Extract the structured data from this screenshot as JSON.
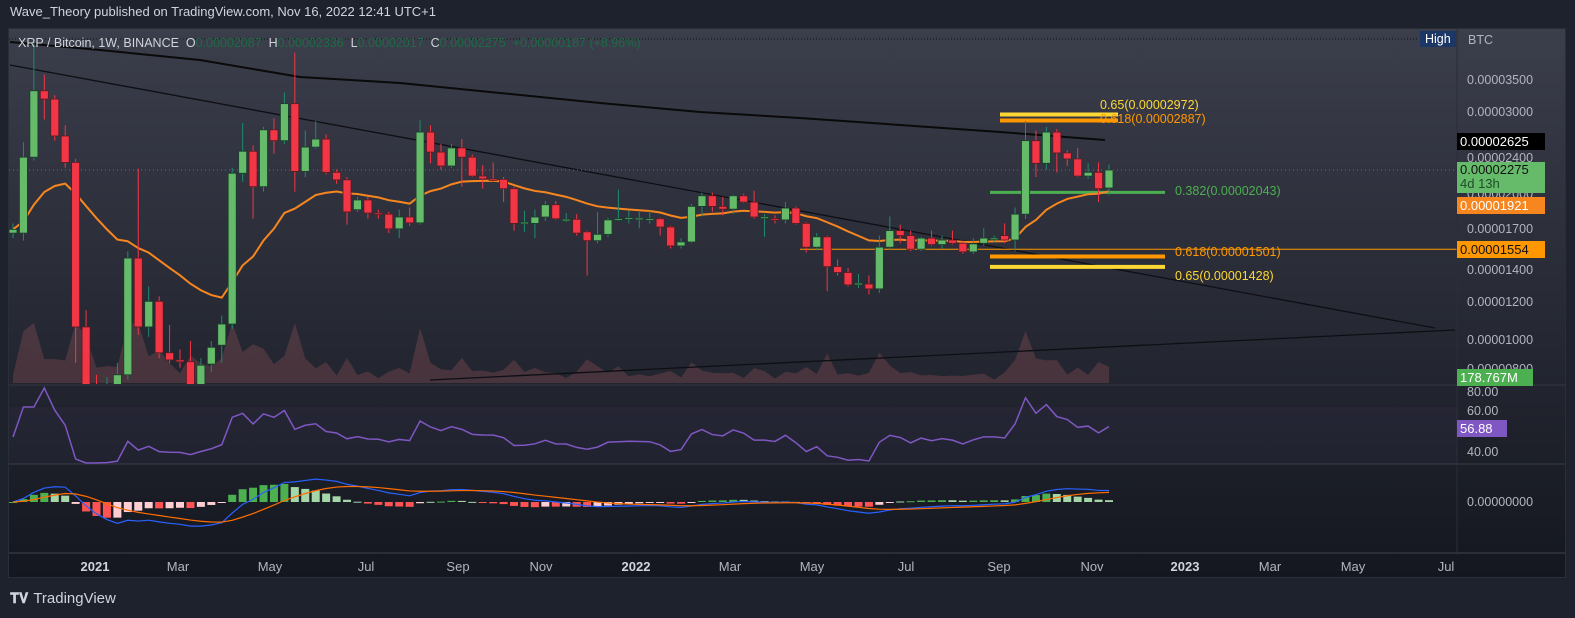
{
  "header": {
    "published": "Wave_Theory published on TradingView.com, Nov 16, 2022 12:41 UTC+1"
  },
  "legend": {
    "symbol": "XRP / Bitcoin, 1W, BINANCE",
    "o_label": "O",
    "o": "0.00002087",
    "h_label": "H",
    "h": "0.00002336",
    "l_label": "L",
    "l": "0.00002017",
    "c_label": "C",
    "c": "0.00002275",
    "change": "+0.00000187 (+8.96%)"
  },
  "scale": {
    "high_badge": "High",
    "currency": "BTC",
    "ticks": [
      "0.00003500",
      "0.00003000",
      "0.00002400",
      "0.00002000",
      "0.00001700",
      "0.00001400",
      "0.00001200",
      "0.00001000",
      "0.00000800"
    ],
    "ma200_tag": "0.00002625",
    "last_price_tag": "0.00002275",
    "countdown": "4d 13h",
    "ema_tag": "0.00001921",
    "hline_tag": "0.00001554",
    "volume_tag": "178.767M",
    "rsi_ticks": [
      "80.00",
      "60.00",
      "40.00"
    ],
    "rsi_tag": "56.88",
    "macd_tick": "0.00000000"
  },
  "fib": [
    {
      "label": "0.65(0.00002972)",
      "price": 2972,
      "color": "#fdd835"
    },
    {
      "label": "0.618(0.00002887)",
      "price": 2887,
      "color": "#ff9800"
    },
    {
      "label": "0.382(0.00002043)",
      "price": 2043,
      "color": "#4caf50"
    },
    {
      "label": "0.618(0.00001501)",
      "price": 1501,
      "color": "#ff9800"
    },
    {
      "label": "0.65(0.00001428)",
      "price": 1428,
      "color": "#fdd835"
    }
  ],
  "time_axis": [
    {
      "t": "2021",
      "b": true
    },
    {
      "t": "Mar"
    },
    {
      "t": "May"
    },
    {
      "t": "Jul"
    },
    {
      "t": "Sep"
    },
    {
      "t": "Nov"
    },
    {
      "t": "2022",
      "b": true
    },
    {
      "t": "Mar"
    },
    {
      "t": "May"
    },
    {
      "t": "Jul"
    },
    {
      "t": "Sep"
    },
    {
      "t": "Nov"
    },
    {
      "t": "2023",
      "b": true
    },
    {
      "t": "Mar"
    },
    {
      "t": "May"
    },
    {
      "t": "Jul"
    }
  ],
  "footer": {
    "brand": "TradingView"
  },
  "colors": {
    "up": "#66bb6a",
    "down": "#f23645",
    "ema": "#f7861f",
    "rsi": "#7e57c2",
    "macd": "#2962ff",
    "signal": "#ff6d00"
  },
  "chart_data": {
    "type": "candlestick",
    "title": "XRP / Bitcoin, 1W, BINANCE",
    "units": "satoshi (1e-8 BTC)",
    "scale": "log",
    "ylim": [
      750,
      4300
    ],
    "hline": 1554,
    "ma200_last": 2625,
    "ema_last": 1921,
    "rsi_last": 56.88,
    "volume_last": "178.767M",
    "candles_ohlc": [
      [
        1680,
        1760,
        1640,
        1710
      ],
      [
        1680,
        2600,
        1620,
        2420
      ],
      [
        2420,
        4200,
        2380,
        3330
      ],
      [
        3330,
        3600,
        2900,
        3200
      ],
      [
        3200,
        3260,
        2620,
        2680
      ],
      [
        2680,
        2820,
        2300,
        2360
      ],
      [
        2360,
        2400,
        900,
        1070
      ],
      [
        1070,
        1160,
        760,
        800
      ],
      [
        800,
        850,
        740,
        780
      ],
      [
        780,
        840,
        720,
        810
      ],
      [
        810,
        900,
        780,
        850
      ],
      [
        850,
        1540,
        830,
        1490
      ],
      [
        1490,
        2290,
        1030,
        1070
      ],
      [
        1070,
        1300,
        1020,
        1210
      ],
      [
        1210,
        1240,
        920,
        945
      ],
      [
        945,
        1080,
        900,
        913
      ],
      [
        913,
        960,
        880,
        905
      ],
      [
        905,
        1000,
        780,
        800
      ],
      [
        800,
        920,
        770,
        890
      ],
      [
        895,
        1000,
        860,
        970
      ],
      [
        980,
        1130,
        900,
        1085
      ],
      [
        1085,
        2300,
        1060,
        2240
      ],
      [
        2240,
        2850,
        2150,
        2490
      ],
      [
        2490,
        2560,
        1800,
        2100
      ],
      [
        2100,
        2800,
        2050,
        2760
      ],
      [
        2760,
        2920,
        2460,
        2620
      ],
      [
        2620,
        3300,
        2580,
        3130
      ],
      [
        3130,
        4000,
        2050,
        2260
      ],
      [
        2260,
        2750,
        2200,
        2540
      ],
      [
        2540,
        2880,
        2520,
        2640
      ],
      [
        2640,
        2700,
        2230,
        2250
      ],
      [
        2250,
        2280,
        2130,
        2170
      ],
      [
        2170,
        2200,
        1750,
        1860
      ],
      [
        1880,
        2000,
        1860,
        1970
      ],
      [
        1970,
        2000,
        1800,
        1850
      ],
      [
        1850,
        1880,
        1800,
        1840
      ],
      [
        1840,
        1860,
        1680,
        1715
      ],
      [
        1715,
        1880,
        1640,
        1815
      ],
      [
        1815,
        1900,
        1740,
        1765
      ],
      [
        1765,
        2890,
        1750,
        2730
      ],
      [
        2730,
        2820,
        2350,
        2480
      ],
      [
        2480,
        2580,
        2280,
        2320
      ],
      [
        2320,
        2580,
        2300,
        2530
      ],
      [
        2530,
        2640,
        2100,
        2420
      ],
      [
        2420,
        2450,
        2200,
        2210
      ],
      [
        2210,
        2330,
        2080,
        2180
      ],
      [
        2180,
        2360,
        2150,
        2175
      ],
      [
        2175,
        2200,
        1950,
        2080
      ],
      [
        2080,
        2100,
        1700,
        1760
      ],
      [
        1770,
        1870,
        1690,
        1770
      ],
      [
        1760,
        1880,
        1640,
        1815
      ],
      [
        1815,
        1960,
        1780,
        1925
      ],
      [
        1925,
        1960,
        1790,
        1800
      ],
      [
        1795,
        1850,
        1770,
        1795
      ],
      [
        1795,
        1840,
        1660,
        1680
      ],
      [
        1690,
        1700,
        1370,
        1620
      ],
      [
        1620,
        1860,
        1600,
        1670
      ],
      [
        1670,
        1810,
        1650,
        1790
      ],
      [
        1800,
        2070,
        1780,
        1800
      ],
      [
        1810,
        1870,
        1760,
        1810
      ],
      [
        1805,
        1860,
        1720,
        1805
      ],
      [
        1800,
        1870,
        1760,
        1800
      ],
      [
        1800,
        1810,
        1660,
        1730
      ],
      [
        1730,
        1740,
        1560,
        1580
      ],
      [
        1580,
        1640,
        1560,
        1610
      ],
      [
        1610,
        1930,
        1600,
        1910
      ],
      [
        1910,
        2040,
        1820,
        2010
      ],
      [
        2010,
        2040,
        1860,
        1910
      ],
      [
        1910,
        2000,
        1830,
        1885
      ],
      [
        1885,
        2020,
        1840,
        2010
      ],
      [
        2010,
        2030,
        1940,
        1950
      ],
      [
        1950,
        2060,
        1800,
        1815
      ],
      [
        1815,
        1840,
        1650,
        1815
      ],
      [
        1800,
        1830,
        1760,
        1790
      ],
      [
        1790,
        1950,
        1760,
        1895
      ],
      [
        1895,
        1910,
        1750,
        1760
      ],
      [
        1760,
        1770,
        1530,
        1570
      ],
      [
        1570,
        1680,
        1550,
        1650
      ],
      [
        1650,
        1660,
        1270,
        1430
      ],
      [
        1430,
        1480,
        1370,
        1390
      ],
      [
        1390,
        1420,
        1300,
        1310
      ],
      [
        1320,
        1380,
        1290,
        1320
      ],
      [
        1315,
        1370,
        1250,
        1285
      ],
      [
        1285,
        1660,
        1260,
        1570
      ],
      [
        1570,
        1820,
        1550,
        1700
      ],
      [
        1700,
        1750,
        1600,
        1660
      ],
      [
        1660,
        1700,
        1540,
        1555
      ],
      [
        1555,
        1650,
        1540,
        1640
      ],
      [
        1640,
        1700,
        1580,
        1590
      ],
      [
        1590,
        1660,
        1560,
        1625
      ],
      [
        1625,
        1700,
        1590,
        1600
      ],
      [
        1600,
        1620,
        1520,
        1535
      ],
      [
        1535,
        1640,
        1520,
        1595
      ],
      [
        1600,
        1720,
        1580,
        1640
      ],
      [
        1640,
        1660,
        1610,
        1640
      ],
      [
        1660,
        1760,
        1600,
        1625
      ],
      [
        1625,
        1900,
        1540,
        1840
      ],
      [
        1840,
        2880,
        1800,
        2620
      ],
      [
        2620,
        2750,
        2200,
        2350
      ],
      [
        2350,
        2800,
        2280,
        2730
      ],
      [
        2730,
        2770,
        2250,
        2470
      ],
      [
        2470,
        2500,
        2320,
        2400
      ],
      [
        2400,
        2530,
        2200,
        2210
      ],
      [
        2210,
        2350,
        2180,
        2250
      ],
      [
        2250,
        2360,
        1950,
        2080
      ],
      [
        2087,
        2336,
        2017,
        2275
      ]
    ]
  }
}
